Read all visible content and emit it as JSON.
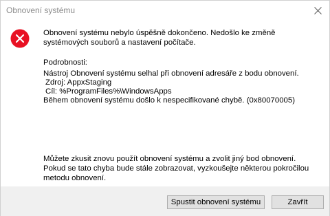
{
  "window": {
    "title": "Obnovení systému"
  },
  "message": {
    "headline": "Obnovení systému nebylo úspěšně dokončeno. Nedošlo ke změně systémových souborů a nastavení počítače.",
    "details_label": "Podrobnosti:",
    "details_lines": [
      "Nástroj Obnovení systému selhal při obnovení adresáře z bodu obnovení.",
      " Zdroj: AppxStaging",
      " Cíl: %ProgramFiles%\\WindowsApps",
      "Během obnovení systému došlo k nespecifikované chybě. (0x80070005)"
    ],
    "suggestion": "Můžete zkusit znovu použít obnovení systému a zvolit jiný bod obnovení. Pokud se tato chyba bude stále zobrazovat, vyzkoušejte některou pokročilou metodu obnovení."
  },
  "buttons": {
    "restore_label": "Spustit obnovení systému",
    "close_label": "Zavřít"
  },
  "icons": {
    "error": "error-icon",
    "close": "close-icon"
  },
  "colors": {
    "error_red": "#e81123",
    "footer_bg": "#f0f0f0",
    "title_text": "#8a8a8a"
  }
}
